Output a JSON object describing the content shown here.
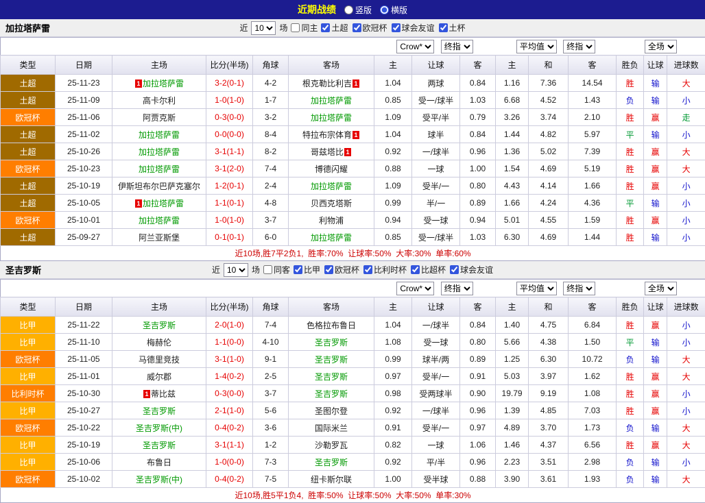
{
  "topbar": {
    "title": "近期战绩",
    "layout_options": [
      {
        "label": "竖版",
        "selected": false
      },
      {
        "label": "横版",
        "selected": true
      }
    ]
  },
  "league_colors": {
    "土超": "#a06a00",
    "欧冠杯": "#ff7e00",
    "比甲": "#ffb000",
    "比利时杯": "#ff7e00"
  },
  "result_colors": {
    "胜": "#e60000",
    "平": "#009933",
    "负": "#1111cc",
    "赢": "#e60000",
    "走": "#009933",
    "输": "#1111cc",
    "大": "#e60000",
    "小": "#1111cc"
  },
  "sections": [
    {
      "team": "加拉塔萨雷",
      "filters": {
        "prefix": "近",
        "count": "10",
        "suffix": "场",
        "same_venue": {
          "label": "同主",
          "checked": false
        },
        "leagues": [
          {
            "label": "土超",
            "checked": true
          },
          {
            "label": "欧冠杯",
            "checked": true
          },
          {
            "label": "球会友谊",
            "checked": true
          },
          {
            "label": "土杯",
            "checked": true
          }
        ]
      },
      "dropdowns": {
        "asian_source": "Crow*",
        "asian_type": "终指",
        "euro_source": "平均值",
        "euro_type": "终指",
        "scope": "全场"
      },
      "columns": [
        "类型",
        "日期",
        "主场",
        "比分(半场)",
        "角球",
        "客场",
        "主",
        "让球",
        "客",
        "主",
        "和",
        "客",
        "胜负",
        "让球",
        "进球数"
      ],
      "rows": [
        {
          "league": "土超",
          "date": "25-11-23",
          "home": {
            "name": "加拉塔萨雷",
            "focus": true,
            "card_before": "1"
          },
          "score": "3-2(0-1)",
          "corner": "4-2",
          "away": {
            "name": "根克勒比利吉",
            "card_after": "1"
          },
          "asian": [
            "1.04",
            "两球",
            "0.84"
          ],
          "euro": [
            "1.16",
            "7.36",
            "14.54"
          ],
          "results": [
            "胜",
            "输",
            "大"
          ]
        },
        {
          "league": "土超",
          "date": "25-11-09",
          "home": {
            "name": "高卡尔利"
          },
          "score": "1-0(1-0)",
          "corner": "1-7",
          "away": {
            "name": "加拉塔萨雷",
            "focus": true
          },
          "asian": [
            "0.85",
            "受一/球半",
            "1.03"
          ],
          "euro": [
            "6.68",
            "4.52",
            "1.43"
          ],
          "results": [
            "负",
            "输",
            "小"
          ]
        },
        {
          "league": "欧冠杯",
          "date": "25-11-06",
          "home": {
            "name": "阿贾克斯"
          },
          "score": "0-3(0-0)",
          "corner": "3-2",
          "away": {
            "name": "加拉塔萨雷",
            "focus": true
          },
          "asian": [
            "1.09",
            "受平/半",
            "0.79"
          ],
          "euro": [
            "3.26",
            "3.74",
            "2.10"
          ],
          "results": [
            "胜",
            "赢",
            "走"
          ]
        },
        {
          "league": "土超",
          "date": "25-11-02",
          "home": {
            "name": "加拉塔萨雷",
            "focus": true
          },
          "score": "0-0(0-0)",
          "corner": "8-4",
          "away": {
            "name": "特拉布宗体育",
            "card_after": "1"
          },
          "asian": [
            "1.04",
            "球半",
            "0.84"
          ],
          "euro": [
            "1.44",
            "4.82",
            "5.97"
          ],
          "results": [
            "平",
            "输",
            "小"
          ]
        },
        {
          "league": "土超",
          "date": "25-10-26",
          "home": {
            "name": "加拉塔萨雷",
            "focus": true
          },
          "score": "3-1(1-1)",
          "corner": "8-2",
          "away": {
            "name": "哥兹塔比",
            "card_after": "1"
          },
          "asian": [
            "0.92",
            "一/球半",
            "0.96"
          ],
          "euro": [
            "1.36",
            "5.02",
            "7.39"
          ],
          "results": [
            "胜",
            "赢",
            "大"
          ]
        },
        {
          "league": "欧冠杯",
          "date": "25-10-23",
          "home": {
            "name": "加拉塔萨雷",
            "focus": true
          },
          "score": "3-1(2-0)",
          "corner": "7-4",
          "away": {
            "name": "博德闪耀"
          },
          "asian": [
            "0.88",
            "一球",
            "1.00"
          ],
          "euro": [
            "1.54",
            "4.69",
            "5.19"
          ],
          "results": [
            "胜",
            "赢",
            "大"
          ]
        },
        {
          "league": "土超",
          "date": "25-10-19",
          "home": {
            "name": "伊斯坦布尔巴萨克塞尔"
          },
          "score": "1-2(0-1)",
          "corner": "2-4",
          "away": {
            "name": "加拉塔萨雷",
            "focus": true
          },
          "asian": [
            "1.09",
            "受半/一",
            "0.80"
          ],
          "euro": [
            "4.43",
            "4.14",
            "1.66"
          ],
          "results": [
            "胜",
            "赢",
            "小"
          ]
        },
        {
          "league": "土超",
          "date": "25-10-05",
          "home": {
            "name": "加拉塔萨雷",
            "focus": true,
            "card_before": "1"
          },
          "score": "1-1(0-1)",
          "corner": "4-8",
          "away": {
            "name": "贝西克塔斯"
          },
          "asian": [
            "0.99",
            "半/一",
            "0.89"
          ],
          "euro": [
            "1.66",
            "4.24",
            "4.36"
          ],
          "results": [
            "平",
            "输",
            "小"
          ]
        },
        {
          "league": "欧冠杯",
          "date": "25-10-01",
          "home": {
            "name": "加拉塔萨雷",
            "focus": true
          },
          "score": "1-0(1-0)",
          "corner": "3-7",
          "away": {
            "name": "利物浦"
          },
          "asian": [
            "0.94",
            "受一球",
            "0.94"
          ],
          "euro": [
            "5.01",
            "4.55",
            "1.59"
          ],
          "results": [
            "胜",
            "赢",
            "小"
          ]
        },
        {
          "league": "土超",
          "date": "25-09-27",
          "home": {
            "name": "阿兰亚斯堡"
          },
          "score": "0-1(0-1)",
          "corner": "6-0",
          "away": {
            "name": "加拉塔萨雷",
            "focus": true
          },
          "asian": [
            "0.85",
            "受一/球半",
            "1.03"
          ],
          "euro": [
            "6.30",
            "4.69",
            "1.44"
          ],
          "results": [
            "胜",
            "输",
            "小"
          ]
        }
      ],
      "summary": "近10场,胜7平2负1,  胜率:70%  让球率:50%  大率:30%  单率:60%"
    },
    {
      "team": "圣吉罗斯",
      "filters": {
        "prefix": "近",
        "count": "10",
        "suffix": "场",
        "same_venue": {
          "label": "同客",
          "checked": false
        },
        "leagues": [
          {
            "label": "比甲",
            "checked": true
          },
          {
            "label": "欧冠杯",
            "checked": true
          },
          {
            "label": "比利时杯",
            "checked": true
          },
          {
            "label": "比超杯",
            "checked": true
          },
          {
            "label": "球会友谊",
            "checked": true
          }
        ]
      },
      "dropdowns": {
        "asian_source": "Crow*",
        "asian_type": "终指",
        "euro_source": "平均值",
        "euro_type": "终指",
        "scope": "全场"
      },
      "columns": [
        "类型",
        "日期",
        "主场",
        "比分(半场)",
        "角球",
        "客场",
        "主",
        "让球",
        "客",
        "主",
        "和",
        "客",
        "胜负",
        "让球",
        "进球数"
      ],
      "rows": [
        {
          "league": "比甲",
          "date": "25-11-22",
          "home": {
            "name": "圣吉罗斯",
            "focus": true
          },
          "score": "2-0(1-0)",
          "corner": "7-4",
          "away": {
            "name": "色格拉布鲁日"
          },
          "asian": [
            "1.04",
            "一/球半",
            "0.84"
          ],
          "euro": [
            "1.40",
            "4.75",
            "6.84"
          ],
          "results": [
            "胜",
            "赢",
            "小"
          ]
        },
        {
          "league": "比甲",
          "date": "25-11-10",
          "home": {
            "name": "梅赫伦"
          },
          "score": "1-1(0-0)",
          "corner": "4-10",
          "away": {
            "name": "圣吉罗斯",
            "focus": true
          },
          "asian": [
            "1.08",
            "受一球",
            "0.80"
          ],
          "euro": [
            "5.66",
            "4.38",
            "1.50"
          ],
          "results": [
            "平",
            "输",
            "小"
          ]
        },
        {
          "league": "欧冠杯",
          "date": "25-11-05",
          "home": {
            "name": "马德里竞技"
          },
          "score": "3-1(1-0)",
          "corner": "9-1",
          "away": {
            "name": "圣吉罗斯",
            "focus": true
          },
          "asian": [
            "0.99",
            "球半/两",
            "0.89"
          ],
          "euro": [
            "1.25",
            "6.30",
            "10.72"
          ],
          "results": [
            "负",
            "输",
            "大"
          ]
        },
        {
          "league": "比甲",
          "date": "25-11-01",
          "home": {
            "name": "威尔郡"
          },
          "score": "1-4(0-2)",
          "corner": "2-5",
          "away": {
            "name": "圣吉罗斯",
            "focus": true
          },
          "asian": [
            "0.97",
            "受半/一",
            "0.91"
          ],
          "euro": [
            "5.03",
            "3.97",
            "1.62"
          ],
          "results": [
            "胜",
            "赢",
            "大"
          ]
        },
        {
          "league": "比利时杯",
          "date": "25-10-30",
          "home": {
            "name": "蒂比兹",
            "card_before": "1"
          },
          "score": "0-3(0-0)",
          "corner": "3-7",
          "away": {
            "name": "圣吉罗斯",
            "focus": true
          },
          "asian": [
            "0.98",
            "受两球半",
            "0.90"
          ],
          "euro": [
            "19.79",
            "9.19",
            "1.08"
          ],
          "results": [
            "胜",
            "赢",
            "小"
          ]
        },
        {
          "league": "比甲",
          "date": "25-10-27",
          "home": {
            "name": "圣吉罗斯",
            "focus": true
          },
          "score": "2-1(1-0)",
          "corner": "5-6",
          "away": {
            "name": "圣图尔登"
          },
          "asian": [
            "0.92",
            "一/球半",
            "0.96"
          ],
          "euro": [
            "1.39",
            "4.85",
            "7.03"
          ],
          "results": [
            "胜",
            "赢",
            "小"
          ]
        },
        {
          "league": "欧冠杯",
          "date": "25-10-22",
          "home": {
            "name": "圣吉罗斯(中)",
            "focus": true
          },
          "score": "0-4(0-2)",
          "corner": "3-6",
          "away": {
            "name": "国际米兰"
          },
          "asian": [
            "0.91",
            "受半/一",
            "0.97"
          ],
          "euro": [
            "4.89",
            "3.70",
            "1.73"
          ],
          "results": [
            "负",
            "输",
            "大"
          ]
        },
        {
          "league": "比甲",
          "date": "25-10-19",
          "home": {
            "name": "圣吉罗斯",
            "focus": true
          },
          "score": "3-1(1-1)",
          "corner": "1-2",
          "away": {
            "name": "沙勒罗瓦"
          },
          "asian": [
            "0.82",
            "一球",
            "1.06"
          ],
          "euro": [
            "1.46",
            "4.37",
            "6.56"
          ],
          "results": [
            "胜",
            "赢",
            "大"
          ]
        },
        {
          "league": "比甲",
          "date": "25-10-06",
          "home": {
            "name": "布鲁日"
          },
          "score": "1-0(0-0)",
          "corner": "7-3",
          "away": {
            "name": "圣吉罗斯",
            "focus": true
          },
          "asian": [
            "0.92",
            "平/半",
            "0.96"
          ],
          "euro": [
            "2.23",
            "3.51",
            "2.98"
          ],
          "results": [
            "负",
            "输",
            "小"
          ]
        },
        {
          "league": "欧冠杯",
          "date": "25-10-02",
          "home": {
            "name": "圣吉罗斯(中)",
            "focus": true
          },
          "score": "0-4(0-2)",
          "corner": "7-5",
          "away": {
            "name": "纽卡斯尔联"
          },
          "asian": [
            "1.00",
            "受半球",
            "0.88"
          ],
          "euro": [
            "3.90",
            "3.61",
            "1.93"
          ],
          "results": [
            "负",
            "输",
            "大"
          ]
        }
      ],
      "summary": "近10场,胜5平1负4,  胜率:50%  让球率:50%  大率:50%  单率:30%"
    }
  ]
}
